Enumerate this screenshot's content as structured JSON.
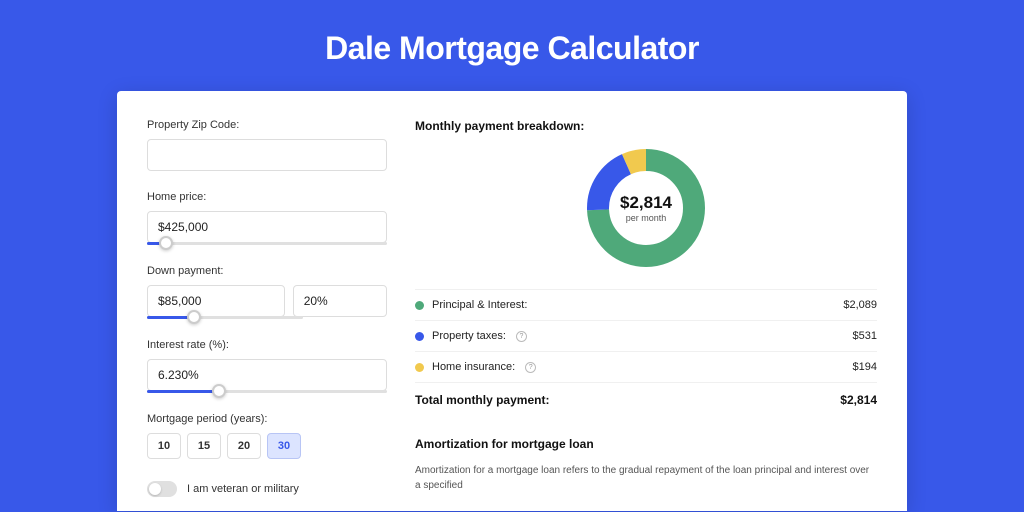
{
  "title": "Dale Mortgage Calculator",
  "form": {
    "zip_label": "Property Zip Code:",
    "zip_value": "",
    "home_price_label": "Home price:",
    "home_price_value": "$425,000",
    "home_price_slider_pct": 8,
    "down_payment_label": "Down payment:",
    "down_payment_value": "$85,000",
    "down_payment_pct_value": "20%",
    "down_payment_slider_pct": 20,
    "interest_label": "Interest rate (%):",
    "interest_value": "6.230%",
    "interest_slider_pct": 30,
    "period_label": "Mortgage period (years):",
    "periods": [
      "10",
      "15",
      "20",
      "30"
    ],
    "period_active": "30",
    "veteran_label": "I am veteran or military",
    "veteran_on": false
  },
  "breakdown": {
    "title": "Monthly payment breakdown:",
    "center_amount": "$2,814",
    "center_sub": "per month",
    "items": [
      {
        "label": "Principal & Interest:",
        "value": "$2,089",
        "color": "g",
        "has_help": false
      },
      {
        "label": "Property taxes:",
        "value": "$531",
        "color": "b",
        "has_help": true
      },
      {
        "label": "Home insurance:",
        "value": "$194",
        "color": "y",
        "has_help": true
      }
    ],
    "total_label": "Total monthly payment:",
    "total_value": "$2,814"
  },
  "amortization": {
    "title": "Amortization for mortgage loan",
    "text": "Amortization for a mortgage loan refers to the gradual repayment of the loan principal and interest over a specified"
  },
  "chart_data": {
    "type": "pie",
    "title": "Monthly payment breakdown",
    "series": [
      {
        "name": "Principal & Interest",
        "value": 2089,
        "color": "#4FA97A"
      },
      {
        "name": "Property taxes",
        "value": 531,
        "color": "#3858E9"
      },
      {
        "name": "Home insurance",
        "value": 194,
        "color": "#F1C94E"
      }
    ],
    "total": 2814,
    "unit": "USD/month"
  }
}
